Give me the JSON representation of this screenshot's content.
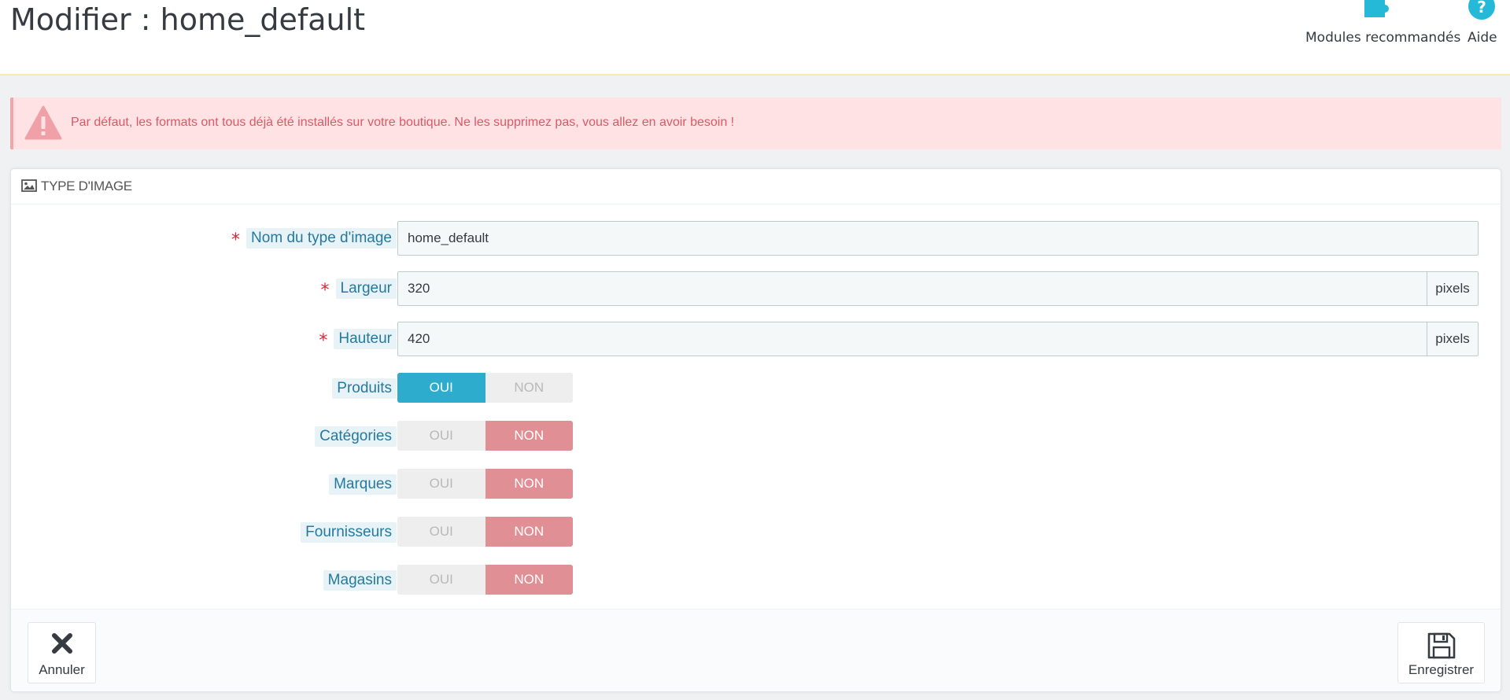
{
  "header": {
    "title": "Modifier : home_default",
    "toolbar": {
      "modules_label": "Modules recommandés",
      "help_label": "Aide"
    }
  },
  "alert": {
    "text": "Par défaut, les formats ont tous déjà été installés sur votre boutique. Ne les supprimez pas, vous allez en avoir besoin !"
  },
  "panel": {
    "title": "TYPE D'IMAGE",
    "fields": {
      "name": {
        "label": "Nom du type d'image",
        "value": "home_default"
      },
      "width": {
        "label": "Largeur",
        "value": "320",
        "unit": "pixels"
      },
      "height": {
        "label": "Hauteur",
        "value": "420",
        "unit": "pixels"
      }
    },
    "switch_yes": "OUI",
    "switch_no": "NON",
    "toggles": {
      "products": {
        "label": "Produits",
        "selected": "OUI"
      },
      "categories": {
        "label": "Catégories",
        "selected": "NON"
      },
      "brands": {
        "label": "Marques",
        "selected": "NON"
      },
      "suppliers": {
        "label": "Fournisseurs",
        "selected": "NON"
      },
      "stores": {
        "label": "Magasins",
        "selected": "NON"
      }
    },
    "footer": {
      "cancel_label": "Annuler",
      "save_label": "Enregistrer"
    }
  },
  "colors": {
    "accent": "#25b9d7",
    "switch_yes": "#2eacce",
    "switch_no": "#e08f95",
    "alert_bg": "#ffe2e4",
    "alert_text": "#d95a67",
    "label_text": "#25799e"
  },
  "icons": {
    "modules": "puzzle-icon",
    "help": "question-circle-icon",
    "alert": "warning-triangle-icon",
    "panel": "image-icon",
    "cancel": "close-icon",
    "save": "floppy-disk-icon"
  }
}
